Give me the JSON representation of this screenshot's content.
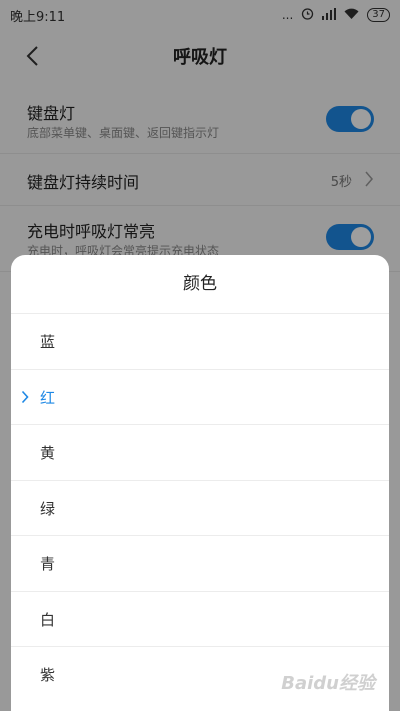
{
  "status_bar": {
    "time": "晚上9:11",
    "dots": "...",
    "battery": "37",
    "icons": [
      "alarm-icon",
      "signal-icon",
      "wifi-icon",
      "battery-icon"
    ]
  },
  "header": {
    "title": "呼吸灯",
    "back_icon": "back-chevron-icon"
  },
  "settings": {
    "keyboard_light": {
      "title": "键盘灯",
      "subtitle": "底部菜单键、桌面键、返回键指示灯",
      "enabled": true
    },
    "duration": {
      "title": "键盘灯持续时间",
      "value": "5秒"
    },
    "charging": {
      "title": "充电时呼吸灯常亮",
      "subtitle": "充电时，呼吸灯会常亮提示充电状态",
      "enabled": true
    }
  },
  "dialog": {
    "title": "颜色",
    "options": [
      {
        "label": "蓝"
      },
      {
        "label": "红",
        "selected": true
      },
      {
        "label": "黄"
      },
      {
        "label": "绿"
      },
      {
        "label": "青"
      },
      {
        "label": "白"
      },
      {
        "label": "紫"
      }
    ]
  },
  "colors": {
    "accent": "#1e88e5",
    "overlay": "rgba(0,0,0,0.38)"
  },
  "watermark": "Baidu经验"
}
